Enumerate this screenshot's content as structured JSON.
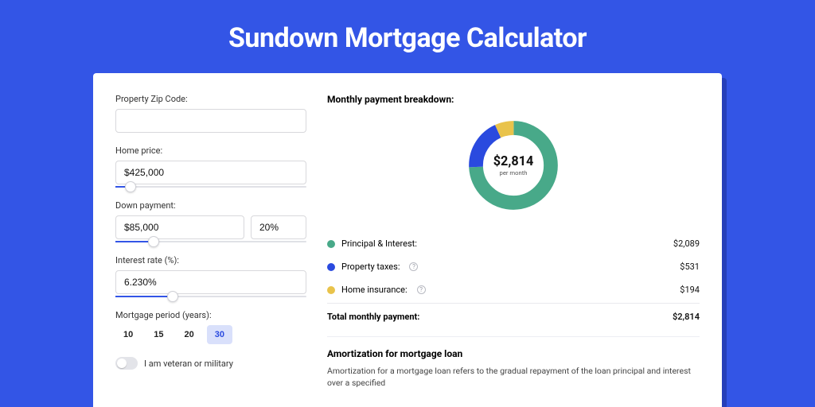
{
  "page_title": "Sundown Mortgage Calculator",
  "form": {
    "zip_label": "Property Zip Code:",
    "zip_value": "",
    "home_price_label": "Home price:",
    "home_price_value": "$425,000",
    "home_price_slider_pct": 8,
    "down_payment_label": "Down payment:",
    "down_payment_amount": "$85,000",
    "down_payment_pct": "20%",
    "down_payment_slider_pct": 20,
    "interest_label": "Interest rate (%):",
    "interest_value": "6.230%",
    "interest_slider_pct": 30,
    "period_label": "Mortgage period (years):",
    "periods": [
      "10",
      "15",
      "20",
      "30"
    ],
    "period_active_index": 3,
    "veteran_label": "I am veteran or military",
    "veteran_on": false
  },
  "breakdown": {
    "title": "Monthly payment breakdown:",
    "total_amount": "$2,814",
    "total_sub": "per month",
    "items": [
      {
        "label": "Principal & Interest:",
        "value": "$2,089",
        "color": "green",
        "info": false,
        "num": 2089
      },
      {
        "label": "Property taxes:",
        "value": "$531",
        "color": "blue",
        "info": true,
        "num": 531
      },
      {
        "label": "Home insurance:",
        "value": "$194",
        "color": "yellow",
        "info": true,
        "num": 194
      }
    ],
    "total_row_label": "Total monthly payment:",
    "total_row_value": "$2,814"
  },
  "chart_data": {
    "type": "pie",
    "title": "Monthly payment breakdown",
    "categories": [
      "Principal & Interest",
      "Property taxes",
      "Home insurance"
    ],
    "values": [
      2089,
      531,
      194
    ],
    "colors": [
      "#48a989",
      "#2a4adf",
      "#e9c34b"
    ],
    "center_label": "$2,814",
    "center_sub": "per month"
  },
  "amortization": {
    "title": "Amortization for mortgage loan",
    "text": "Amortization for a mortgage loan refers to the gradual repayment of the loan principal and interest over a specified"
  }
}
